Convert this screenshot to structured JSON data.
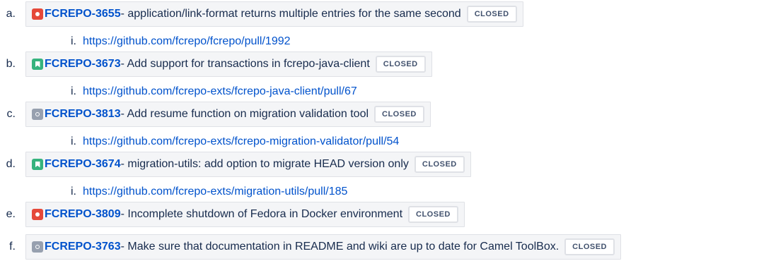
{
  "items": [
    {
      "marker": "a.",
      "type": "bug",
      "icon_name": "bug-icon",
      "key": "FCREPO-3655",
      "summary": " - application/link-format returns multiple entries for the same second",
      "status": "CLOSED",
      "sub_marker": "i.",
      "link": "https://github.com/fcrepo/fcrepo/pull/1992"
    },
    {
      "marker": "b.",
      "type": "story",
      "icon_name": "story-icon",
      "key": "FCREPO-3673",
      "summary": " - Add support for transactions in fcrepo-java-client",
      "status": "CLOSED",
      "sub_marker": "i.",
      "link": "https://github.com/fcrepo-exts/fcrepo-java-client/pull/67"
    },
    {
      "marker": "c.",
      "type": "task",
      "icon_name": "task-icon",
      "key": "FCREPO-3813",
      "summary": " - Add resume function on migration validation tool",
      "status": "CLOSED",
      "sub_marker": "i.",
      "link": "https://github.com/fcrepo-exts/fcrepo-migration-validator/pull/54"
    },
    {
      "marker": "d.",
      "type": "story",
      "icon_name": "story-icon",
      "key": "FCREPO-3674",
      "summary": " - migration-utils: add option to migrate HEAD version only",
      "status": "CLOSED",
      "sub_marker": "i.",
      "link": "https://github.com/fcrepo-exts/migration-utils/pull/185"
    },
    {
      "marker": "e.",
      "type": "bug",
      "icon_name": "bug-icon",
      "key": "FCREPO-3809",
      "summary": " - Incomplete shutdown of Fedora in Docker environment",
      "status": "CLOSED"
    },
    {
      "marker": "f.",
      "type": "task",
      "icon_name": "task-icon",
      "key": "FCREPO-3763",
      "summary": " - Make sure that documentation in README and wiki are up to date for Camel ToolBox.",
      "status": "CLOSED"
    }
  ],
  "colors": {
    "link": "#0052cc",
    "bug": "#e5493a",
    "story": "#36b37e",
    "task": "#97a0af",
    "box_bg": "#f4f5f7",
    "box_border": "#dfe1e6"
  }
}
